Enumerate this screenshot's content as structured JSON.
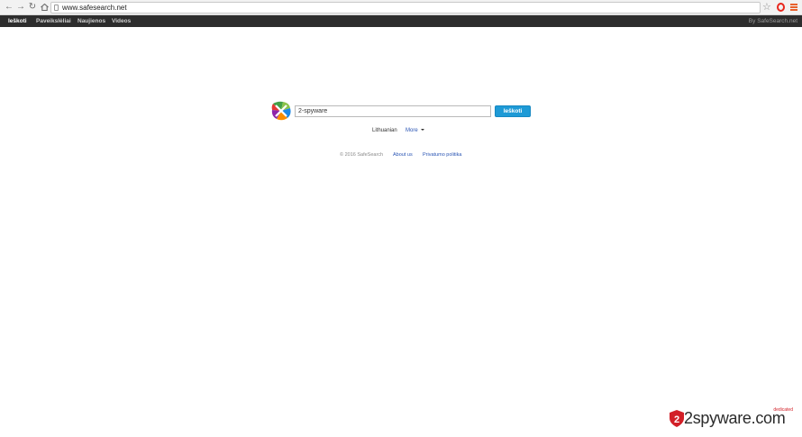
{
  "browser": {
    "url": "www.safesearch.net",
    "icons": [
      "back-icon",
      "forward-icon",
      "reload-icon",
      "home-icon",
      "page-icon",
      "star-icon",
      "opera-icon",
      "menu-icon"
    ]
  },
  "nav": {
    "items": [
      {
        "label": "Ieškoti",
        "active": true
      },
      {
        "label": "Paveikslėliai",
        "active": false
      },
      {
        "label": "Naujienos",
        "active": false
      },
      {
        "label": "Videos",
        "active": false
      }
    ],
    "brand": "By SafeSearch.net"
  },
  "search": {
    "value": "2-spyware",
    "button_label": "Ieškoti"
  },
  "language": {
    "current": "Lithuanian",
    "more_label": "More"
  },
  "footer": {
    "copyright": "© 2016 SafeSearch",
    "about": "About us",
    "privacy": "Privatumo politika"
  },
  "watermark": {
    "text": "2spyware.com",
    "tag": "dedicated"
  },
  "colors": {
    "topbar": "#2d2d2d",
    "search_button": "#1e9ad6",
    "link": "#2a55b4"
  }
}
